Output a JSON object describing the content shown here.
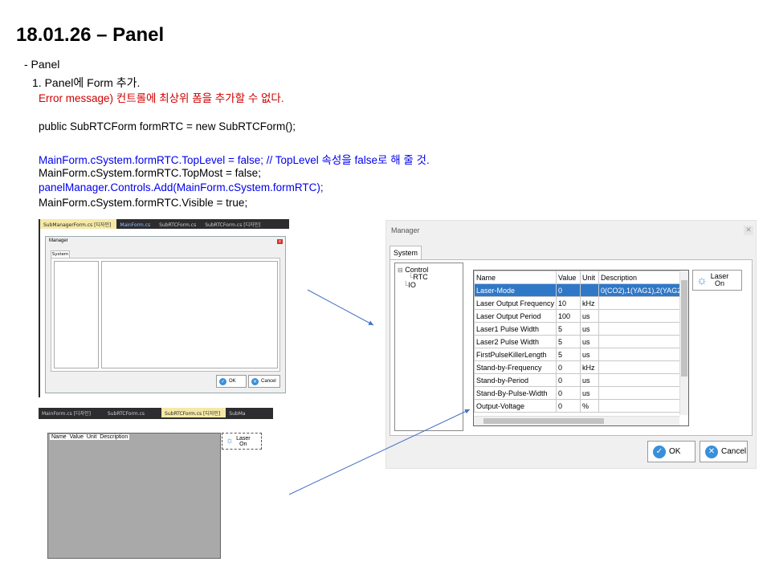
{
  "title": "18.01.26 – Panel",
  "notes": {
    "bullet": "- Panel",
    "item1": "1. Panel에 Form 추가.",
    "error_line": "Error message) 컨트롤에 최상위 폼을 추가할 수 없다.",
    "code1": "public  SubRTCForm  formRTC  =  new  SubRTCForm();",
    "code2": "MainForm.cSystem.formRTC.TopLevel = false;     // TopLevel 속성을 false로 해 줄 것.",
    "code3": "MainForm.cSystem.formRTC.TopMost  =  false;",
    "code4": "panelManager.Controls.Add(MainForm.cSystem.formRTC);",
    "code5": "MainForm.cSystem.formRTC.Visible  =  true;"
  },
  "shot1": {
    "tabs": [
      "SubManagerForm.cs [디자인]",
      "MainForm.cs",
      "SubRTCForm.cs",
      "SubRTCForm.cs [디자인]"
    ],
    "window_title": "Manager",
    "tab_label": "System",
    "ok_label": "OK",
    "cancel_label": "Cancel"
  },
  "manager": {
    "window_title": "Manager",
    "tab_label": "System",
    "tree": [
      "Control",
      "RTC",
      "IO"
    ],
    "columns": [
      "Name",
      "Value",
      "Unit",
      "Description"
    ],
    "rows": [
      {
        "name": "Laser-Mode",
        "value": "0",
        "unit": "",
        "description": "0(CO2),1(YAG1),2(YAG2"
      },
      {
        "name": "Laser Output Frequency",
        "value": "10",
        "unit": "kHz",
        "description": ""
      },
      {
        "name": "Laser Output Period",
        "value": "100",
        "unit": "us",
        "description": ""
      },
      {
        "name": "Laser1 Pulse Width",
        "value": "5",
        "unit": "us",
        "description": ""
      },
      {
        "name": "Laser2 Pulse Width",
        "value": "5",
        "unit": "us",
        "description": ""
      },
      {
        "name": "FirstPulseKillerLength",
        "value": "5",
        "unit": "us",
        "description": ""
      },
      {
        "name": "Stand-by-Frequency",
        "value": "0",
        "unit": "kHz",
        "description": ""
      },
      {
        "name": "Stand-by-Period",
        "value": "0",
        "unit": "us",
        "description": ""
      },
      {
        "name": "Stand-By-Pulse-Width",
        "value": "0",
        "unit": "us",
        "description": ""
      },
      {
        "name": "Output-Voltage",
        "value": "0",
        "unit": "%",
        "description": ""
      }
    ],
    "laser_button": "Laser\nOn",
    "ok_label": "OK",
    "cancel_label": "Cancel"
  },
  "shot2": {
    "tabs": [
      "MainForm.cs [디자인]",
      "SubRTCForm.cs",
      "SubRTCForm.cs [디자인]",
      "SubMa"
    ],
    "columns": [
      "Name",
      "Value",
      "Unit",
      "Description"
    ],
    "laser_button": "Laser\nOn"
  },
  "colors": {
    "selected_row": "#2f78c8",
    "arrow": "#4472c4",
    "error_text": "#d00000",
    "highlight_text": "#0000ee"
  }
}
